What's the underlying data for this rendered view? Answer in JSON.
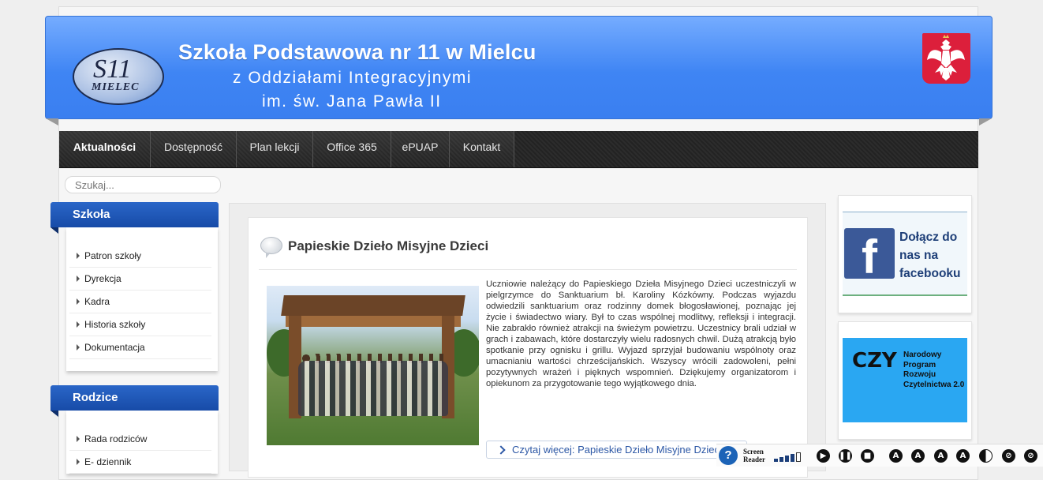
{
  "header": {
    "logo_num": "S11",
    "logo_city": "MIELEC",
    "title": "Szkoła Podstawowa nr 11 w Mielcu",
    "subtitle1": "z Oddziałami Integracyjnymi",
    "subtitle2": "im. św. Jana Pawła  II"
  },
  "nav": {
    "items": [
      "Aktualności",
      "Dostępność",
      "Plan lekcji",
      "Office 365",
      "ePUAP",
      "Kontakt"
    ]
  },
  "search": {
    "placeholder": "Szukaj..."
  },
  "sidebar": {
    "sections": [
      {
        "title": "Szkoła",
        "items": [
          "Patron szkoły",
          "Dyrekcja",
          "Kadra",
          "Historia szkoły",
          "Dokumentacja"
        ]
      },
      {
        "title": "Rodzice",
        "items": [
          "Rada rodziców",
          "E- dziennik"
        ]
      }
    ]
  },
  "article": {
    "title": "Papieskie Dzieło Misyjne Dzieci",
    "body": "Uczniowie należący do Papieskiego Dzieła Misyjnego Dzieci uczestniczyli w pielgrzymce do Sanktuarium bł. Karoliny Kózkówny. Podczas wyjazdu odwiedzili sanktuarium oraz rodzinny domek błogosławionej, poznając jej życie i świadectwo wiary. Był to czas wspólnej modlitwy, refleksji i integracji. Nie zabrakło również atrakcji na świeżym powietrzu. Uczestnicy brali udział w grach i zabawach, które dostarczyły wielu radosnych chwil. Dużą atrakcją było spotkanie przy ognisku i grillu. Wyjazd sprzyjał budowaniu wspólnoty oraz umacnianiu wartości chrześcijańskich. Wszyscy wrócili zadowoleni, pełni pozytywnych wrażeń i pięknych wspomnień. Dziękujemy organizatorom i opiekunom za przygotowanie tego wyjątkowego dnia.",
    "read_more": "Czytaj więcej: Papieskie Dzieło Misyjne Dzieci"
  },
  "banners": {
    "facebook": {
      "logo": "f",
      "text": "Dołącz do nas na facebooku"
    },
    "npr": {
      "mark": "CZY",
      "text": "Narodowy Program Rozwoju Czytelnictwa 2.0"
    }
  },
  "accessibility": {
    "screen_reader_label_1": "Screen",
    "screen_reader_label_2": "Reader",
    "icons": [
      "play-icon",
      "pause-icon",
      "stop-icon",
      "font-increase-icon",
      "font-decrease-icon",
      "font-reset-icon",
      "font-readable-icon",
      "contrast-icon",
      "grayscale-icon",
      "invert-icon"
    ]
  },
  "colors": {
    "header_blue": "#3f85f4",
    "sidebar_blue": "#1e56b8",
    "link_blue": "#2d58a6",
    "emblem_red": "#dc1f3b",
    "facebook_blue": "#3b5998",
    "npr_blue": "#2aa7f2"
  }
}
